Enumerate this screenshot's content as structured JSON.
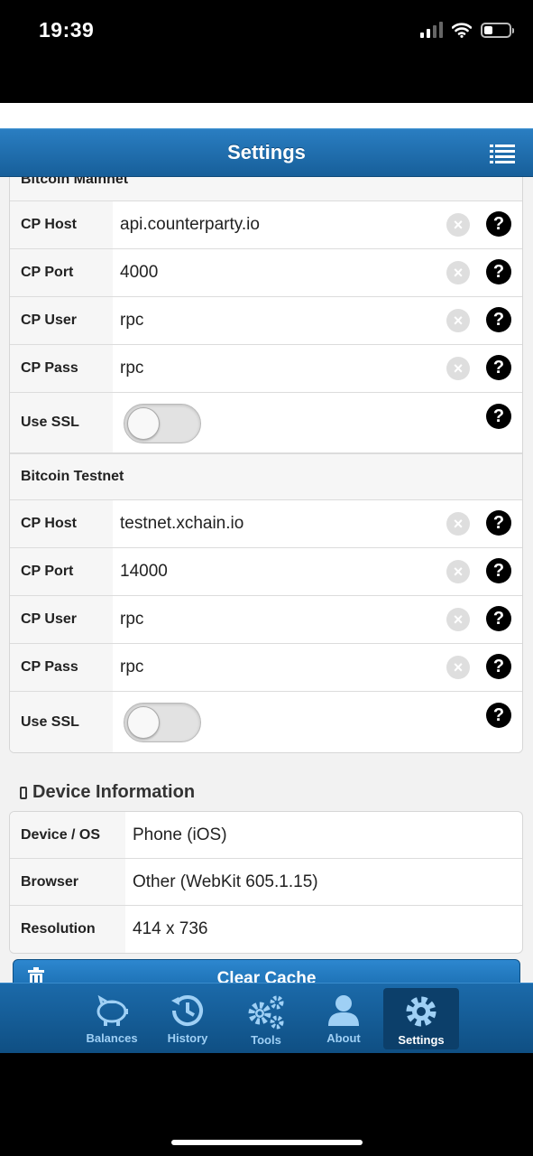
{
  "status_bar": {
    "time": "19:39"
  },
  "header": {
    "title": "Settings"
  },
  "mainnet": {
    "title": "Bitcoin Mainnet",
    "rows": [
      {
        "label": "CP Host",
        "value": "api.counterparty.io"
      },
      {
        "label": "CP Port",
        "value": "4000"
      },
      {
        "label": "CP User",
        "value": "rpc"
      },
      {
        "label": "CP Pass",
        "value": "rpc"
      }
    ],
    "ssl_label": "Use SSL",
    "ssl_enabled": false
  },
  "testnet": {
    "title": "Bitcoin Testnet",
    "rows": [
      {
        "label": "CP Host",
        "value": "testnet.xchain.io"
      },
      {
        "label": "CP Port",
        "value": "14000"
      },
      {
        "label": "CP User",
        "value": "rpc"
      },
      {
        "label": "CP Pass",
        "value": "rpc"
      }
    ],
    "ssl_label": "Use SSL",
    "ssl_enabled": false
  },
  "device": {
    "heading": "Device Information",
    "rows": [
      {
        "label": "Device / OS",
        "value": "Phone (iOS)"
      },
      {
        "label": "Browser",
        "value": "Other (WebKit 605.1.15)"
      },
      {
        "label": "Resolution",
        "value": "414 x 736"
      }
    ]
  },
  "clear_cache_label": "Clear Cache",
  "tabs": [
    {
      "label": "Balances",
      "icon": "piggy-bank-icon"
    },
    {
      "label": "History",
      "icon": "history-icon"
    },
    {
      "label": "Tools",
      "icon": "gears-icon"
    },
    {
      "label": "About",
      "icon": "user-icon"
    },
    {
      "label": "Settings",
      "icon": "gear-icon",
      "active": true
    }
  ],
  "colors": {
    "header": "#1f6fb0",
    "tab_active": "#0c3f6a",
    "tab_icon": "#9fd0f5"
  }
}
